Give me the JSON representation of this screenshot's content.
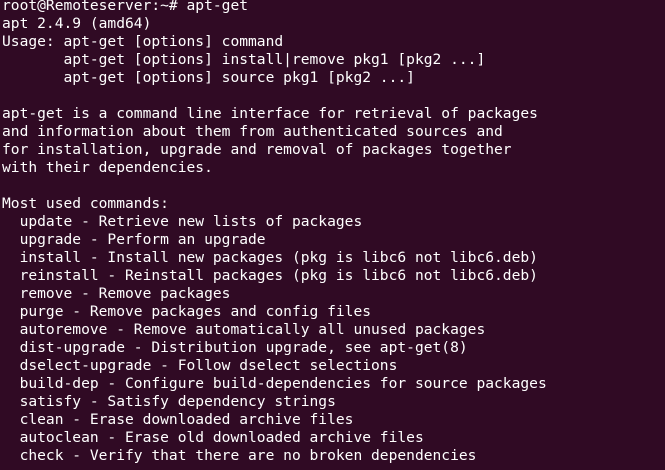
{
  "theme": {
    "background": "#300a24",
    "foreground": "#ffffff"
  },
  "terminal": {
    "lines": [
      "root@Remoteserver:~# apt-get",
      "apt 2.4.9 (amd64)",
      "Usage: apt-get [options] command",
      "       apt-get [options] install|remove pkg1 [pkg2 ...]",
      "       apt-get [options] source pkg1 [pkg2 ...]",
      "",
      "apt-get is a command line interface for retrieval of packages",
      "and information about them from authenticated sources and",
      "for installation, upgrade and removal of packages together",
      "with their dependencies.",
      "",
      "Most used commands:",
      "  update - Retrieve new lists of packages",
      "  upgrade - Perform an upgrade",
      "  install - Install new packages (pkg is libc6 not libc6.deb)",
      "  reinstall - Reinstall packages (pkg is libc6 not libc6.deb)",
      "  remove - Remove packages",
      "  purge - Remove packages and config files",
      "  autoremove - Remove automatically all unused packages",
      "  dist-upgrade - Distribution upgrade, see apt-get(8)",
      "  dselect-upgrade - Follow dselect selections",
      "  build-dep - Configure build-dependencies for source packages",
      "  satisfy - Satisfy dependency strings",
      "  clean - Erase downloaded archive files",
      "  autoclean - Erase old downloaded archive files",
      "  check - Verify that there are no broken dependencies"
    ]
  }
}
